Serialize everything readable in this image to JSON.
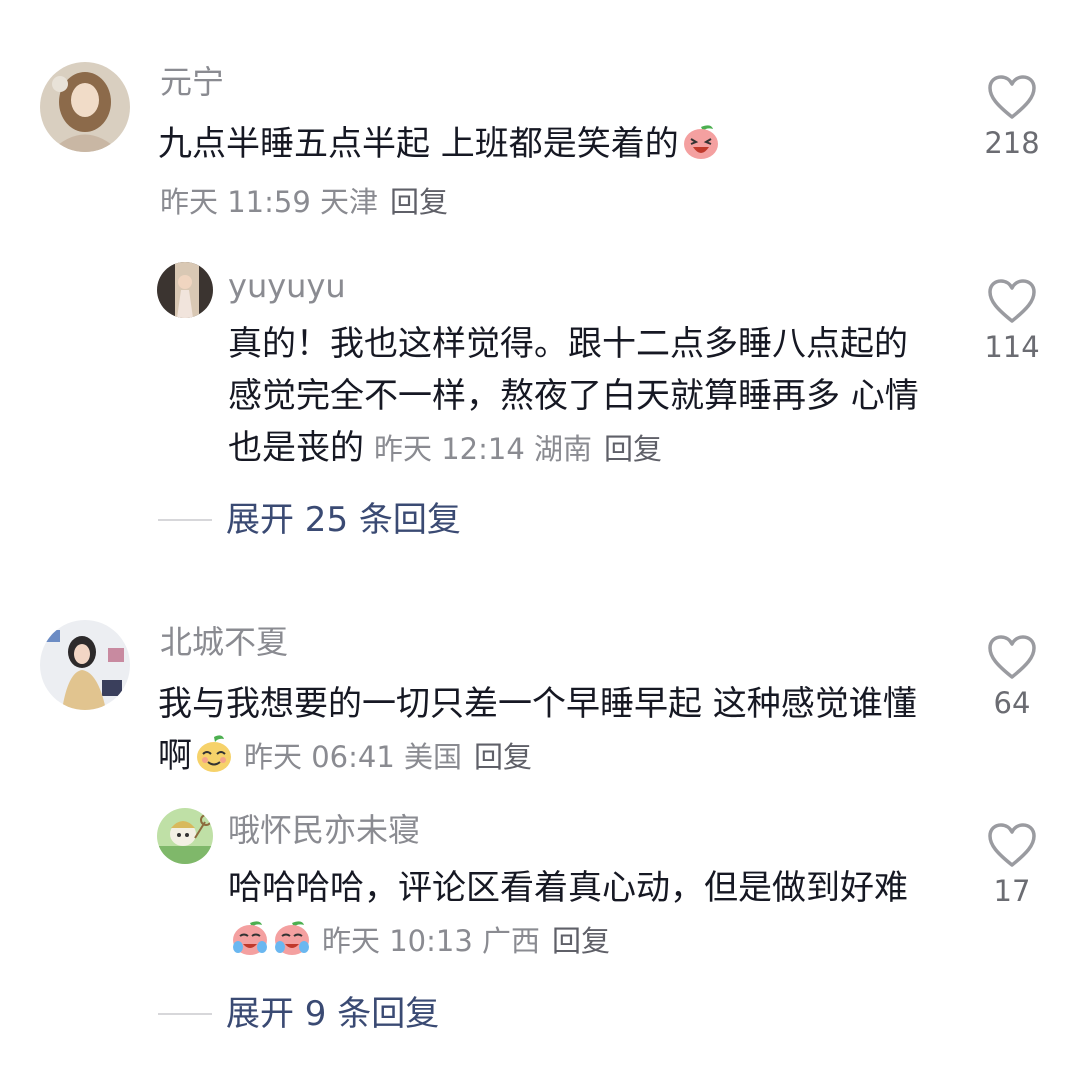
{
  "comments": [
    {
      "user": "元宁",
      "text": "九点半睡五点半起  上班都是笑着的",
      "time": "昨天 11:59 天津",
      "reply_label": "回复",
      "likes": "218",
      "emoji": "laughing-peach-emoji",
      "replies": [
        {
          "user": "yuyuyu",
          "text": "真的！我也这样觉得。跟十二点多睡八点起的感觉完全不一样，熬夜了白天就算睡再多 心情也是丧的",
          "time": "昨天 12:14 湖南",
          "reply_label": "回复",
          "likes": "114"
        }
      ],
      "expand_label": "展开 25 条回复"
    },
    {
      "user": "北城不夏",
      "text": "我与我想要的一切只差一个早睡早起 这种感觉谁懂啊",
      "time": "昨天 06:41 美国",
      "reply_label": "回复",
      "likes": "64",
      "emoji": "smug-pear-emoji",
      "replies": [
        {
          "user": "哦怀民亦未寝",
          "text": "哈哈哈哈，评论区看着真心动，但是做到好难",
          "time": "昨天 10:13 广西",
          "reply_label": "回复",
          "likes": "17",
          "emoji": "crying-peach-emoji"
        }
      ],
      "expand_label": "展开 9 条回复"
    }
  ],
  "icons": {
    "like": "heart-outline-icon"
  },
  "colors": {
    "username": "#8a8b91",
    "text": "#161823",
    "expand": "#3a4a73"
  }
}
